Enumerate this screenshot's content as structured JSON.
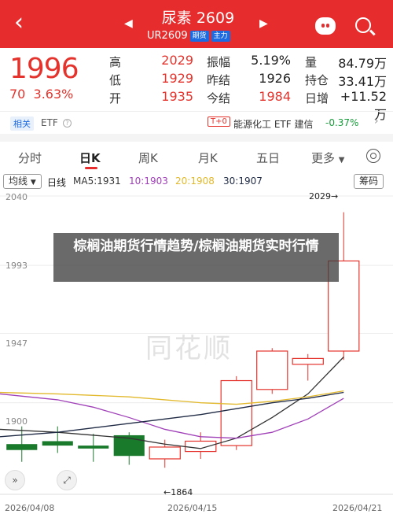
{
  "header": {
    "title": "尿素 2609",
    "code": "UR2609",
    "tags": [
      "期货",
      "主力"
    ],
    "back_icon": "back-chevron-icon",
    "prev_icon": "prev-contract-icon",
    "next_icon": "next-contract-icon",
    "assistant_icon": "robot-icon",
    "search_icon": "search-icon"
  },
  "quote": {
    "price": "1996",
    "change": "70",
    "change_pct": "3.63%",
    "stats": [
      {
        "label": "高",
        "value": "2029",
        "color": "red"
      },
      {
        "label": "振幅",
        "value": "5.19%",
        "color": "dark"
      },
      {
        "label": "量",
        "value": "84.79万",
        "color": "dark"
      },
      {
        "label": "低",
        "value": "1929",
        "color": "red"
      },
      {
        "label": "昨结",
        "value": "1926",
        "color": "dark"
      },
      {
        "label": "持仓",
        "value": "33.41万",
        "color": "dark"
      },
      {
        "label": "开",
        "value": "1935",
        "color": "red"
      },
      {
        "label": "今结",
        "value": "1984",
        "color": "red"
      },
      {
        "label": "日增",
        "value": "+11.52万",
        "color": "dark"
      }
    ]
  },
  "related": {
    "tag": "相关",
    "etf_label": "ETF",
    "t0_tag": "T+0",
    "etf_name": "能源化工 ETF 建信",
    "etf_change": "-0.37%"
  },
  "tabs": [
    "分时",
    "日K",
    "周K",
    "月K",
    "五日",
    "更多"
  ],
  "active_tab": "日K",
  "indicators": {
    "mode_button": "均线",
    "period": "日线",
    "ma5": "MA5:1931",
    "ma10": "10:1903",
    "ma20": "20:1908",
    "ma30": "30:1907",
    "right_button": "筹码"
  },
  "overlay_text": "棕榈油期货行情趋势/棕榈油期货实时行情",
  "chart_data": {
    "type": "candlestick",
    "y_ticks": [
      "2040",
      "1993",
      "1947",
      "1900"
    ],
    "ylim": [
      1838,
      2040
    ],
    "x_labels": [
      "2026/04/08",
      "2026/04/15",
      "2026/04/21"
    ],
    "annotations": {
      "high": "2029→",
      "low": "←1864"
    },
    "candles": [
      {
        "open": 1868,
        "close": 1872,
        "high": 1884,
        "low": 1860,
        "dir": "down"
      },
      {
        "open": 1874,
        "close": 1871,
        "high": 1884,
        "low": 1866,
        "dir": "down"
      },
      {
        "open": 1871,
        "close": 1869,
        "high": 1879,
        "low": 1860,
        "dir": "down"
      },
      {
        "open": 1878,
        "close": 1864,
        "high": 1880,
        "low": 1858,
        "dir": "down"
      },
      {
        "open": 1862,
        "close": 1870,
        "high": 1875,
        "low": 1856,
        "dir": "up"
      },
      {
        "open": 1867,
        "close": 1874,
        "high": 1880,
        "low": 1862,
        "dir": "up"
      },
      {
        "open": 1871,
        "close": 1915,
        "high": 1918,
        "low": 1868,
        "dir": "up"
      },
      {
        "open": 1909,
        "close": 1935,
        "high": 1937,
        "low": 1906,
        "dir": "up"
      },
      {
        "open": 1930,
        "close": 1926,
        "high": 1933,
        "low": 1915,
        "dir": "up"
      },
      {
        "open": 1935,
        "close": 1996,
        "high": 2029,
        "low": 1929,
        "dir": "up"
      }
    ],
    "series": [
      {
        "name": "MA5",
        "color": "#333333",
        "values": [
          1882,
          1880,
          1878,
          1876,
          1872,
          1869,
          1876,
          1890,
          1906,
          1931
        ]
      },
      {
        "name": "MA10",
        "color": "#a040b8",
        "values": [
          1906,
          1902,
          1897,
          1890,
          1882,
          1877,
          1876,
          1880,
          1889,
          1903
        ]
      },
      {
        "name": "MA20",
        "color": "#e2b92c",
        "values": [
          1907,
          1906,
          1905,
          1904,
          1902,
          1900,
          1899,
          1901,
          1904,
          1908
        ]
      },
      {
        "name": "MA30",
        "color": "#1f2a44",
        "values": [
          1877,
          1880,
          1883,
          1886,
          1889,
          1892,
          1896,
          1900,
          1903,
          1907
        ]
      }
    ],
    "colors": {
      "up": "#e4332c",
      "down": "#1a7a2c"
    }
  }
}
